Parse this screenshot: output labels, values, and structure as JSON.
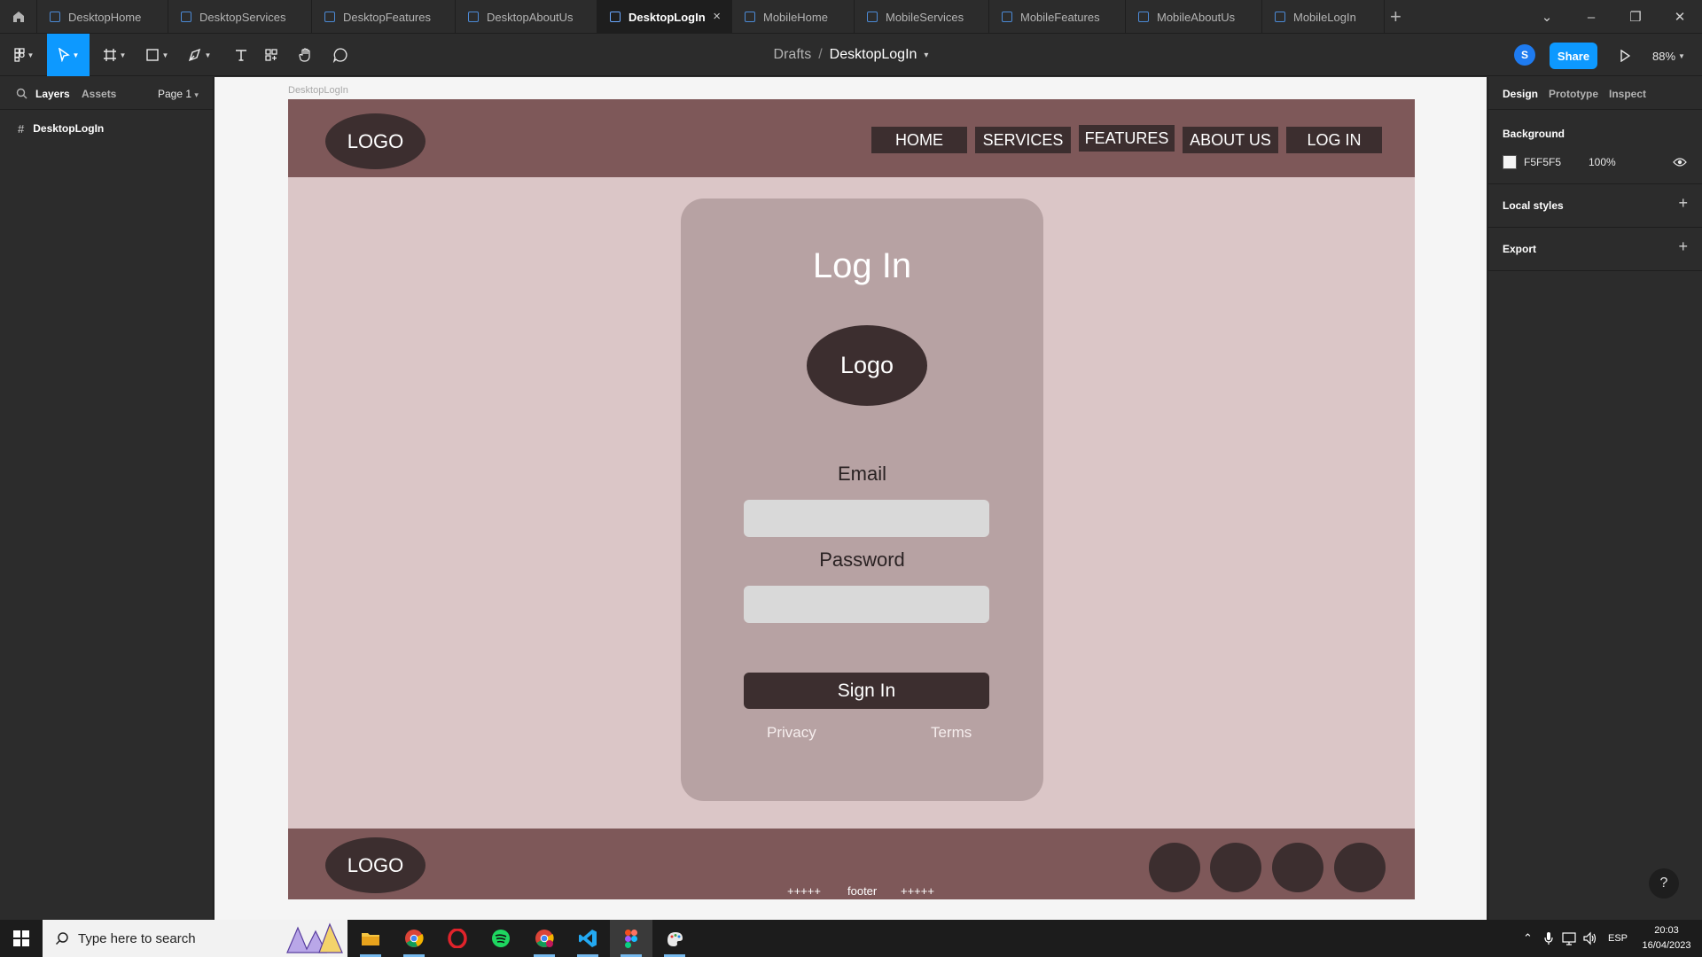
{
  "tabs": [
    {
      "label": "DesktopHome",
      "active": false
    },
    {
      "label": "DesktopServices",
      "active": false
    },
    {
      "label": "DesktopFeatures",
      "active": false
    },
    {
      "label": "DesktopAboutUs",
      "active": false
    },
    {
      "label": "DesktopLogIn",
      "active": true
    },
    {
      "label": "MobileHome",
      "active": false
    },
    {
      "label": "MobileServices",
      "active": false
    },
    {
      "label": "MobileFeatures",
      "active": false
    },
    {
      "label": "MobileAboutUs",
      "active": false
    },
    {
      "label": "MobileLogIn",
      "active": false
    }
  ],
  "tab_close": "×",
  "add_tab": "+",
  "window_controls": {
    "chevron": "⌄",
    "minimize": "–",
    "restore": "❐",
    "close": "✕"
  },
  "toolbar": {
    "breadcrumb": {
      "folder": "Drafts",
      "separator": "/",
      "file": "DesktopLogIn"
    },
    "user_initial": "S",
    "share_label": "Share",
    "zoom": "88%"
  },
  "left_panel": {
    "tabs": {
      "layers": "Layers",
      "assets": "Assets",
      "page": "Page 1"
    },
    "layers": [
      {
        "name": "DesktopLogIn",
        "icon": "frame-icon"
      }
    ]
  },
  "canvas": {
    "frame_label": "DesktopLogIn",
    "navbar": {
      "logo": "LOGO",
      "links": [
        "HOME",
        "SERVICES",
        "FEATURES",
        "ABOUT US",
        "LOG IN"
      ]
    },
    "login_card": {
      "title": "Log In",
      "logo": "Logo",
      "email_label": "Email",
      "email_value": "",
      "password_label": "Password",
      "password_value": "",
      "sign_in": "Sign In",
      "privacy": "Privacy",
      "terms": "Terms"
    },
    "footer": {
      "logo": "LOGO",
      "text_left": "+++++",
      "text_center": "footer",
      "text_right": "+++++",
      "social_count": 4
    }
  },
  "right_panel": {
    "tabs": {
      "design": "Design",
      "prototype": "Prototype",
      "inspect": "Inspect"
    },
    "background": {
      "title": "Background",
      "hex": "F5F5F5",
      "opacity": "100%"
    },
    "local_styles": "Local styles",
    "export": "Export",
    "plus": "+",
    "help": "?"
  },
  "taskbar": {
    "search_placeholder": "Type here to search",
    "language": "ESP",
    "time": "20:03",
    "date": "16/04/2023",
    "apps": [
      "file-explorer-icon",
      "chrome-icon",
      "opera-icon",
      "spotify-icon",
      "chrome-profile-icon",
      "vscode-icon",
      "figma-icon",
      "paint-icon"
    ]
  },
  "colors": {
    "accent": "#0d99ff",
    "frame_bg": "#dbc6c7",
    "navbar": "#7e5859",
    "dark_element": "#3c2e2f",
    "card": "#b7a2a3",
    "input": "#d9d9d9",
    "canvas_bg": "#f5f5f5"
  }
}
